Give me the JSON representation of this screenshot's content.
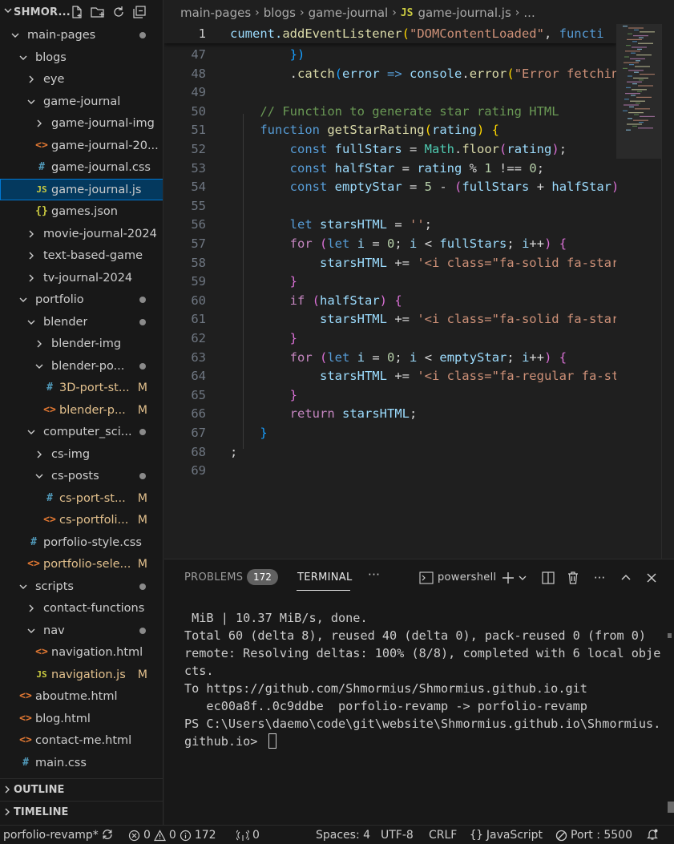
{
  "explorer": {
    "title": "SHMOR...",
    "tree": [
      {
        "label": "main-pages",
        "kind": "folder-open",
        "depth": 0,
        "dot": true
      },
      {
        "label": "blogs",
        "kind": "folder-open",
        "depth": 1
      },
      {
        "label": "eye",
        "kind": "folder",
        "depth": 2
      },
      {
        "label": "game-journal",
        "kind": "folder-open",
        "depth": 2
      },
      {
        "label": "game-journal-img",
        "kind": "folder",
        "depth": 3
      },
      {
        "label": "game-journal-20...",
        "kind": "html",
        "depth": 3
      },
      {
        "label": "game-journal.css",
        "kind": "css",
        "depth": 3
      },
      {
        "label": "game-journal.js",
        "kind": "js",
        "depth": 3,
        "selected": true
      },
      {
        "label": "games.json",
        "kind": "json",
        "depth": 3
      },
      {
        "label": "movie-journal-2024",
        "kind": "folder",
        "depth": 2
      },
      {
        "label": "text-based-game",
        "kind": "folder",
        "depth": 2
      },
      {
        "label": "tv-journal-2024",
        "kind": "folder",
        "depth": 2
      },
      {
        "label": "portfolio",
        "kind": "folder-open",
        "depth": 1,
        "dot": true
      },
      {
        "label": "blender",
        "kind": "folder-open",
        "depth": 2,
        "dot": true
      },
      {
        "label": "blender-img",
        "kind": "folder",
        "depth": 3
      },
      {
        "label": "blender-po...",
        "kind": "folder-open",
        "depth": 3,
        "dot": true
      },
      {
        "label": "3D-port-st...",
        "kind": "css",
        "depth": 4,
        "mod": "M"
      },
      {
        "label": "blender-p...",
        "kind": "html",
        "depth": 4,
        "mod": "M"
      },
      {
        "label": "computer_sci...",
        "kind": "folder-open",
        "depth": 2,
        "dot": true
      },
      {
        "label": "cs-img",
        "kind": "folder",
        "depth": 3
      },
      {
        "label": "cs-posts",
        "kind": "folder-open",
        "depth": 3,
        "dot": true
      },
      {
        "label": "cs-port-st...",
        "kind": "css",
        "depth": 4,
        "mod": "M"
      },
      {
        "label": "cs-portfoli...",
        "kind": "html",
        "depth": 4,
        "mod": "M"
      },
      {
        "label": "porfolio-style.css",
        "kind": "css",
        "depth": 2
      },
      {
        "label": "portfolio-sele...",
        "kind": "html",
        "depth": 2,
        "mod": "M"
      },
      {
        "label": "scripts",
        "kind": "folder-open",
        "depth": 1,
        "dot": true
      },
      {
        "label": "contact-functions",
        "kind": "folder",
        "depth": 2
      },
      {
        "label": "nav",
        "kind": "folder-open",
        "depth": 2,
        "dot": true
      },
      {
        "label": "navigation.html",
        "kind": "html",
        "depth": 3
      },
      {
        "label": "navigation.js",
        "kind": "js",
        "depth": 3,
        "mod": "M"
      },
      {
        "label": "aboutme.html",
        "kind": "html",
        "depth": 1
      },
      {
        "label": "blog.html",
        "kind": "html",
        "depth": 1
      },
      {
        "label": "contact-me.html",
        "kind": "html",
        "depth": 1
      },
      {
        "label": "main.css",
        "kind": "css",
        "depth": 1
      }
    ],
    "outline_label": "OUTLINE",
    "timeline_label": "TIMELINE"
  },
  "breadcrumbs": {
    "items": [
      "main-pages",
      "blogs",
      "game-journal"
    ],
    "file_badge": "JS",
    "file": "game-journal.js",
    "more": "..."
  },
  "editor": {
    "lines": [
      {
        "n": "1",
        "sticky": true,
        "tokens": [
          [
            "cument.",
            "v"
          ],
          [
            "addEventListener",
            "f"
          ],
          [
            "(",
            "y"
          ],
          [
            "\"DOMContentLoaded\"",
            "s"
          ],
          [
            ", ",
            ""
          ],
          [
            "functi",
            "k"
          ]
        ]
      },
      {
        "n": "47",
        "tokens": [
          [
            "        ",
            ""
          ],
          [
            "})",
            "b"
          ]
        ]
      },
      {
        "n": "48",
        "tokens": [
          [
            "        .",
            ""
          ],
          [
            "catch",
            "f"
          ],
          [
            "(",
            "b"
          ],
          [
            "error",
            "v"
          ],
          [
            " => ",
            "k"
          ],
          [
            "console",
            "v"
          ],
          [
            ".",
            ""
          ],
          [
            "error",
            "f"
          ],
          [
            "(",
            "y"
          ],
          [
            "\"Error fetchin",
            "s"
          ]
        ]
      },
      {
        "n": "49",
        "tokens": []
      },
      {
        "n": "50",
        "tokens": [
          [
            "    ",
            ""
          ],
          [
            "// Function to generate star rating HTML",
            "cm"
          ]
        ]
      },
      {
        "n": "51",
        "tokens": [
          [
            "    ",
            ""
          ],
          [
            "function",
            "k"
          ],
          [
            " ",
            ""
          ],
          [
            "getStarRating",
            "f"
          ],
          [
            "(",
            "y"
          ],
          [
            "rating",
            "v"
          ],
          [
            ")",
            "y"
          ],
          [
            " {",
            "y"
          ]
        ]
      },
      {
        "n": "52",
        "tokens": [
          [
            "        ",
            ""
          ],
          [
            "const",
            "k"
          ],
          [
            " ",
            ""
          ],
          [
            "fullStars",
            "v"
          ],
          [
            " = ",
            ""
          ],
          [
            "Math",
            "t"
          ],
          [
            ".",
            ""
          ],
          [
            "floor",
            "f"
          ],
          [
            "(",
            "pk"
          ],
          [
            "rating",
            "v"
          ],
          [
            ")",
            "pk"
          ],
          [
            ";",
            ""
          ]
        ]
      },
      {
        "n": "53",
        "tokens": [
          [
            "        ",
            ""
          ],
          [
            "const",
            "k"
          ],
          [
            " ",
            ""
          ],
          [
            "halfStar",
            "v"
          ],
          [
            " = ",
            ""
          ],
          [
            "rating",
            "v"
          ],
          [
            " % ",
            ""
          ],
          [
            "1",
            "n"
          ],
          [
            " !== ",
            ""
          ],
          [
            "0",
            "n"
          ],
          [
            ";",
            ""
          ]
        ]
      },
      {
        "n": "54",
        "tokens": [
          [
            "        ",
            ""
          ],
          [
            "const",
            "k"
          ],
          [
            " ",
            ""
          ],
          [
            "emptyStar",
            "v"
          ],
          [
            " = ",
            ""
          ],
          [
            "5",
            "n"
          ],
          [
            " - ",
            ""
          ],
          [
            "(",
            "pk"
          ],
          [
            "fullStars",
            "v"
          ],
          [
            " + ",
            ""
          ],
          [
            "halfStar",
            "v"
          ],
          [
            ")",
            "pk"
          ]
        ]
      },
      {
        "n": "55",
        "tokens": []
      },
      {
        "n": "56",
        "tokens": [
          [
            "        ",
            ""
          ],
          [
            "let",
            "k"
          ],
          [
            " ",
            ""
          ],
          [
            "starsHTML",
            "v"
          ],
          [
            " = ",
            ""
          ],
          [
            "''",
            "s"
          ],
          [
            ";",
            ""
          ]
        ]
      },
      {
        "n": "57",
        "tokens": [
          [
            "        ",
            ""
          ],
          [
            "for",
            "c"
          ],
          [
            " ",
            ""
          ],
          [
            "(",
            "pk"
          ],
          [
            "let",
            "k"
          ],
          [
            " ",
            ""
          ],
          [
            "i",
            "v"
          ],
          [
            " = ",
            ""
          ],
          [
            "0",
            "n"
          ],
          [
            "; ",
            ""
          ],
          [
            "i",
            "v"
          ],
          [
            " < ",
            ""
          ],
          [
            "fullStars",
            "v"
          ],
          [
            "; ",
            ""
          ],
          [
            "i",
            "v"
          ],
          [
            "++",
            ""
          ],
          [
            ")",
            "pk"
          ],
          [
            " {",
            "pk"
          ]
        ]
      },
      {
        "n": "58",
        "tokens": [
          [
            "            ",
            ""
          ],
          [
            "starsHTML",
            "v"
          ],
          [
            " += ",
            ""
          ],
          [
            "'<i class=\"fa-solid fa-star",
            "s"
          ]
        ]
      },
      {
        "n": "59",
        "tokens": [
          [
            "        ",
            ""
          ],
          [
            "}",
            "pk"
          ]
        ]
      },
      {
        "n": "60",
        "tokens": [
          [
            "        ",
            ""
          ],
          [
            "if",
            "c"
          ],
          [
            " ",
            ""
          ],
          [
            "(",
            "pk"
          ],
          [
            "halfStar",
            "v"
          ],
          [
            ")",
            "pk"
          ],
          [
            " {",
            "pk"
          ]
        ]
      },
      {
        "n": "61",
        "tokens": [
          [
            "            ",
            ""
          ],
          [
            "starsHTML",
            "v"
          ],
          [
            " += ",
            ""
          ],
          [
            "'<i class=\"fa-solid fa-star",
            "s"
          ]
        ]
      },
      {
        "n": "62",
        "tokens": [
          [
            "        ",
            ""
          ],
          [
            "}",
            "pk"
          ]
        ]
      },
      {
        "n": "63",
        "tokens": [
          [
            "        ",
            ""
          ],
          [
            "for",
            "c"
          ],
          [
            " ",
            ""
          ],
          [
            "(",
            "pk"
          ],
          [
            "let",
            "k"
          ],
          [
            " ",
            ""
          ],
          [
            "i",
            "v"
          ],
          [
            " = ",
            ""
          ],
          [
            "0",
            "n"
          ],
          [
            "; ",
            ""
          ],
          [
            "i",
            "v"
          ],
          [
            " < ",
            ""
          ],
          [
            "emptyStar",
            "v"
          ],
          [
            "; ",
            ""
          ],
          [
            "i",
            "v"
          ],
          [
            "++",
            ""
          ],
          [
            ")",
            "pk"
          ],
          [
            " {",
            "pk"
          ]
        ]
      },
      {
        "n": "64",
        "tokens": [
          [
            "            ",
            ""
          ],
          [
            "starsHTML",
            "v"
          ],
          [
            " += ",
            ""
          ],
          [
            "'<i class=\"fa-regular fa-st",
            "s"
          ]
        ]
      },
      {
        "n": "65",
        "tokens": [
          [
            "        ",
            ""
          ],
          [
            "}",
            "pk"
          ]
        ]
      },
      {
        "n": "66",
        "tokens": [
          [
            "        ",
            ""
          ],
          [
            "return",
            "c"
          ],
          [
            " ",
            ""
          ],
          [
            "starsHTML",
            "v"
          ],
          [
            ";",
            ""
          ]
        ]
      },
      {
        "n": "67",
        "tokens": [
          [
            "    ",
            ""
          ],
          [
            "}",
            "b"
          ]
        ]
      },
      {
        "n": "68",
        "tokens": [
          [
            ";",
            ""
          ]
        ]
      },
      {
        "n": "69",
        "tokens": []
      }
    ]
  },
  "panel": {
    "tab_problems": "PROBLEMS",
    "problems_count": "172",
    "tab_terminal": "TERMINAL",
    "more_tabs": "···",
    "shell_label": "powershell",
    "terminal_lines": [
      " MiB | 10.37 MiB/s, done.",
      "Total 60 (delta 8), reused 40 (delta 0), pack-reused 0 (from 0)",
      "remote: Resolving deltas: 100% (8/8), completed with 6 local obje",
      "cts.",
      "To https://github.com/Shmormius/Shmormius.github.io.git",
      "   ec00a8f..0c9ddbe  porfolio-revamp -> porfolio-revamp",
      "PS C:\\Users\\daemo\\code\\git\\website\\Shmormius.github.io\\Shmormius.",
      "github.io> "
    ]
  },
  "statusbar": {
    "branch": "porfolio-revamp*",
    "errors": "0",
    "warnings": "0",
    "info": "172",
    "ports": "0",
    "spaces": "Spaces: 4",
    "encoding": "UTF-8",
    "eol": "CRLF",
    "language": "JavaScript",
    "port": "Port : 5500"
  },
  "colors": {
    "selection": "#04395e",
    "focus_border": "#0078d4",
    "modified": "#e2c08d",
    "js_icon": "#cbcb41",
    "css_icon": "#519aba",
    "html_icon": "#e37933"
  }
}
